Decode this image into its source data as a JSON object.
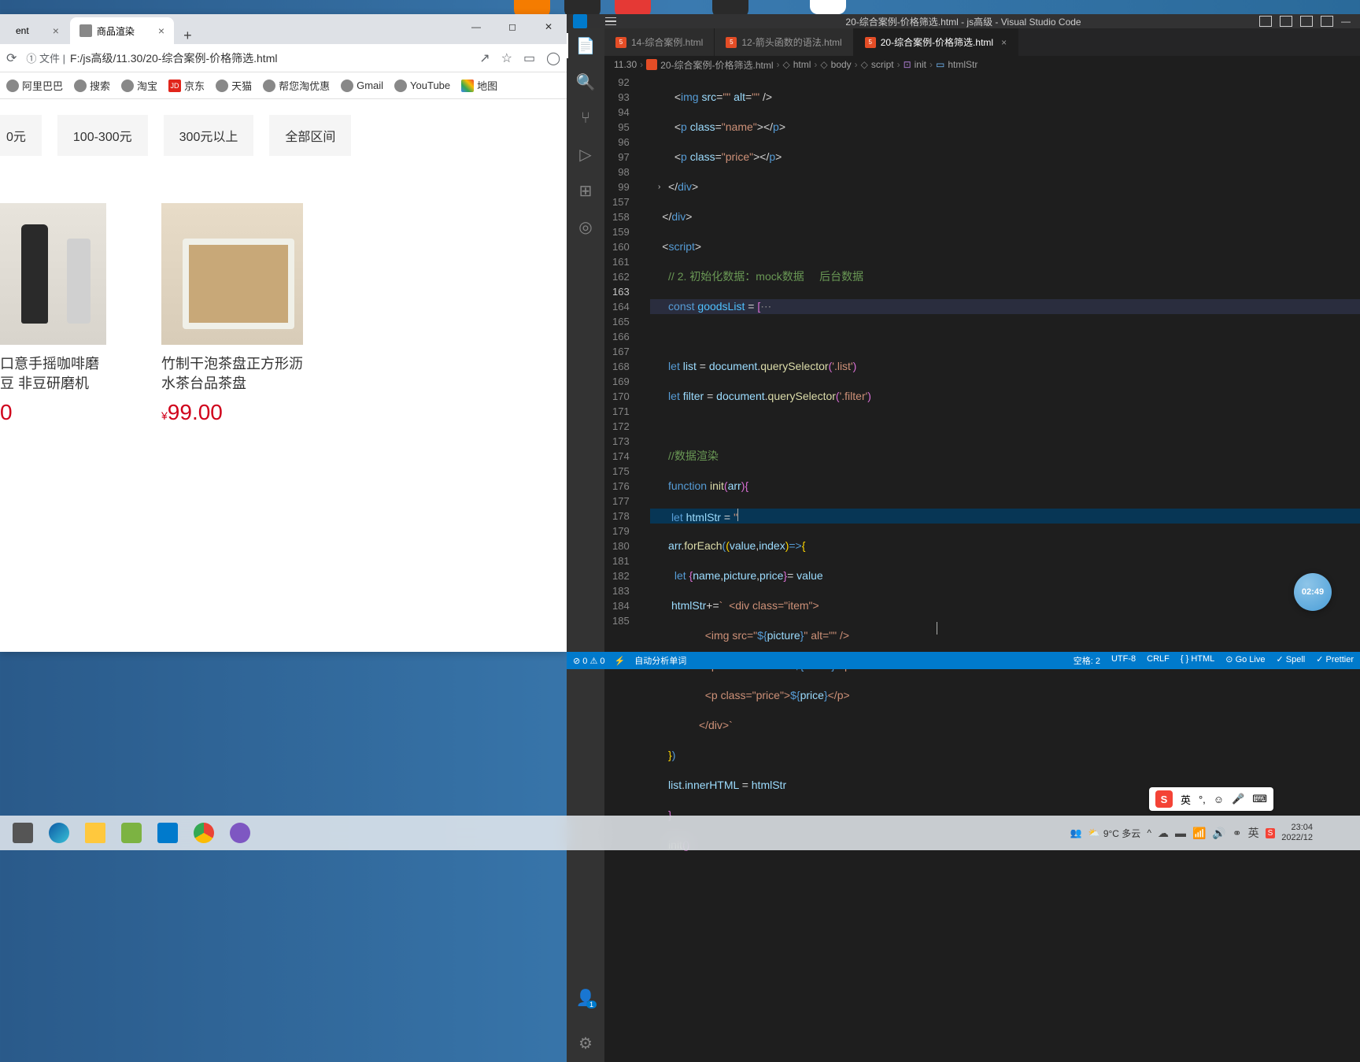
{
  "browser": {
    "tabs": [
      {
        "title": "ent",
        "active": false
      },
      {
        "title": "商品渲染",
        "active": true
      }
    ],
    "url_proto": "① 文件 |",
    "url": "F:/js高级/11.30/20-综合案例-价格筛选.html",
    "bookmarks": [
      "阿里巴巴",
      "搜索",
      "淘宝",
      "京东",
      "天猫",
      "帮您淘优惠",
      "Gmail",
      "YouTube",
      "地图"
    ]
  },
  "page": {
    "filters": [
      "0元",
      "100-300元",
      "300元以上",
      "全部区间"
    ],
    "products": [
      {
        "name": "口意手摇咖啡磨豆\n非豆研磨机",
        "price_prefix": "",
        "price": "0"
      },
      {
        "name": "竹制干泡茶盘正方形沥水茶台品茶盘",
        "price_prefix": "¥",
        "price": "99.00"
      }
    ]
  },
  "vscode": {
    "title": "20-综合案例-价格筛选.html - js高级 - Visual Studio Code",
    "tabs": [
      {
        "name": "14-综合案例.html",
        "active": false
      },
      {
        "name": "12-箭头函数的语法.html",
        "active": false
      },
      {
        "name": "20-综合案例-价格筛选.html",
        "active": true
      }
    ],
    "breadcrumb": [
      "11.30",
      "20-综合案例-价格筛选.html",
      "html",
      "body",
      "script",
      "init",
      "htmlStr"
    ],
    "line_numbers": [
      "92",
      "93",
      "94",
      "95",
      "96",
      "97",
      "98",
      "99",
      "157",
      "158",
      "159",
      "160",
      "161",
      "162",
      "163",
      "164",
      "165",
      "166",
      "167",
      "168",
      "169",
      "170",
      "171",
      "172",
      "173",
      "174",
      "175",
      "176",
      "177",
      "178",
      "179",
      "180",
      "181",
      "182",
      "183",
      "184",
      "185"
    ],
    "status": {
      "errors": "0",
      "warnings": "0",
      "auto_analyze": "自动分析单词",
      "spaces": "空格: 2",
      "encoding": "UTF-8",
      "eol": "CRLF",
      "lang": "HTML",
      "golive": "Go Live",
      "spell": "Spell",
      "prettier": "Prettier"
    }
  },
  "taskbar": {
    "weather": "9°C 多云",
    "time": "23:04",
    "date": "2022/12"
  },
  "float_badge": "02:49",
  "ime": {
    "lang": "英"
  }
}
